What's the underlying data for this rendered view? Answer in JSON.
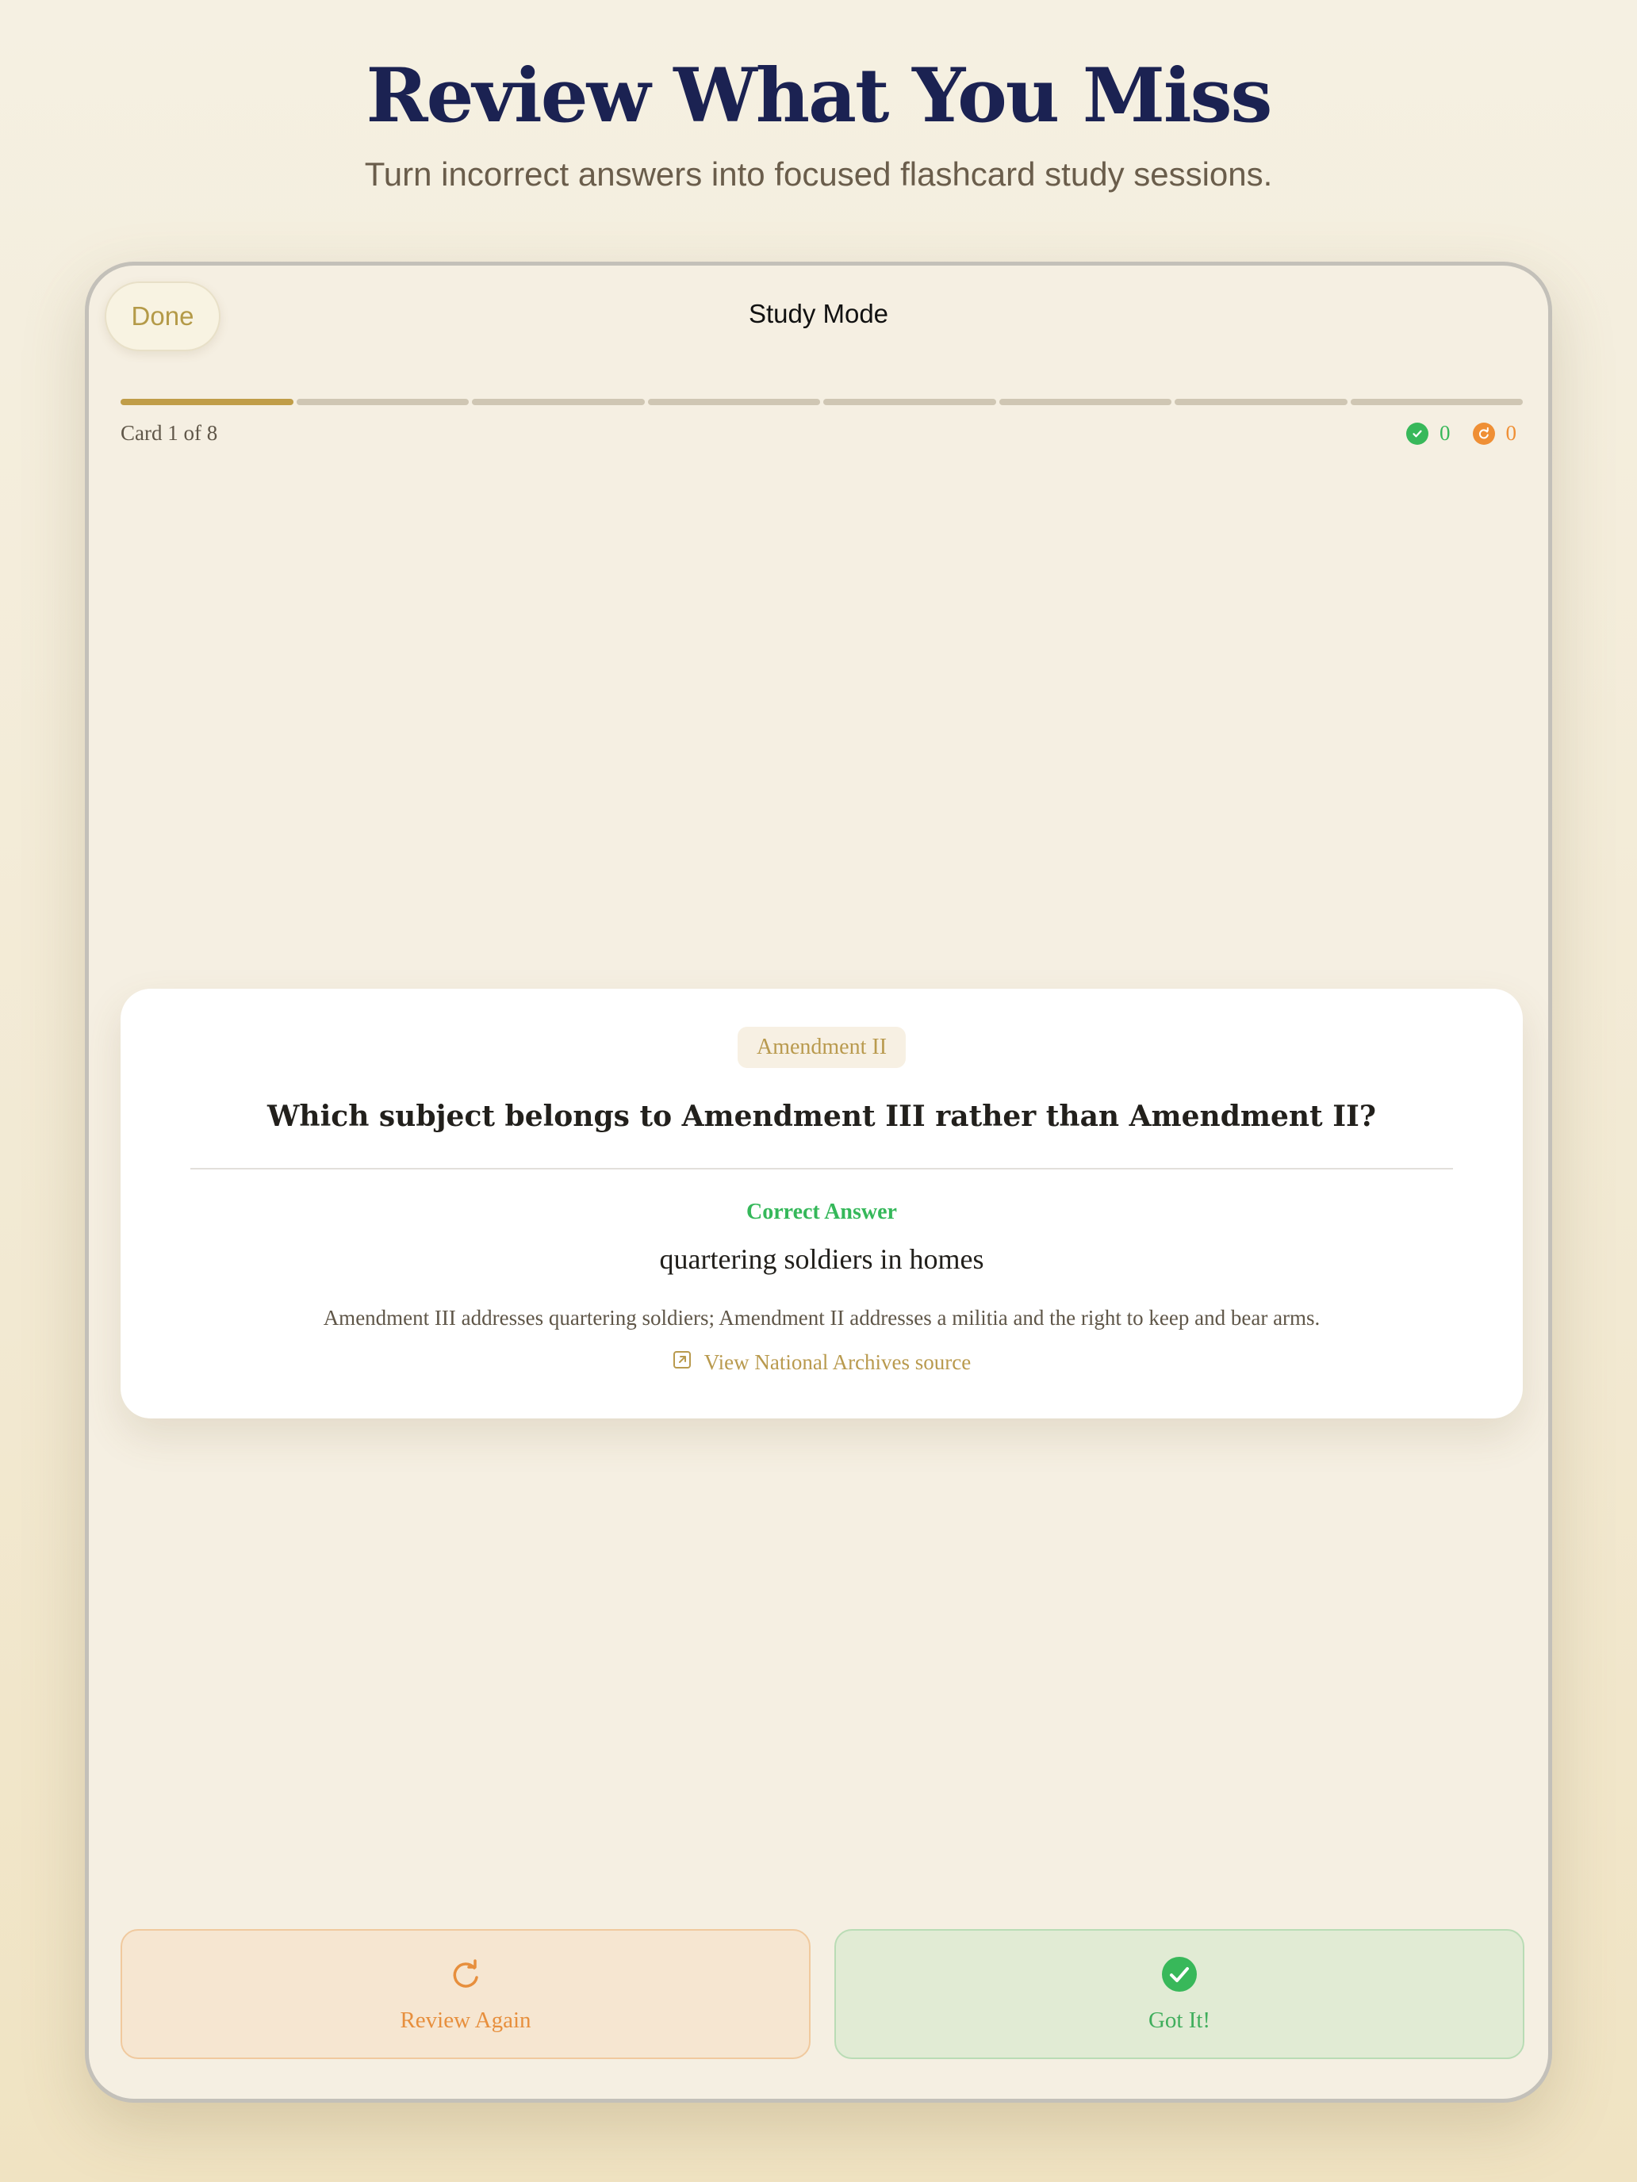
{
  "hero": {
    "title": "Review What You Miss",
    "subtitle": "Turn incorrect answers into focused flashcard study sessions."
  },
  "header": {
    "done_label": "Done",
    "title": "Study Mode"
  },
  "progress": {
    "current": 1,
    "total": 8,
    "label": "Card 1 of 8"
  },
  "tally": {
    "correct_count": "0",
    "review_count": "0"
  },
  "card": {
    "tag": "Amendment II",
    "question": "Which subject belongs to Amendment III rather than Amendment II?",
    "answer_label": "Correct Answer",
    "answer": "quartering soldiers in homes",
    "explanation": "Amendment III addresses quartering soldiers; Amendment II addresses a militia and the right to keep and bear arms.",
    "source_link": "View National Archives source"
  },
  "actions": {
    "review_again": "Review Again",
    "got_it": "Got It!"
  },
  "colors": {
    "accent_gold": "#c09d48",
    "success_green": "#38b85a",
    "review_orange": "#ef8f35",
    "title_navy": "#1b2252"
  },
  "icons": {
    "correct": "checkmark-circle-icon",
    "review": "refresh-icon",
    "source": "external-link-icon"
  }
}
